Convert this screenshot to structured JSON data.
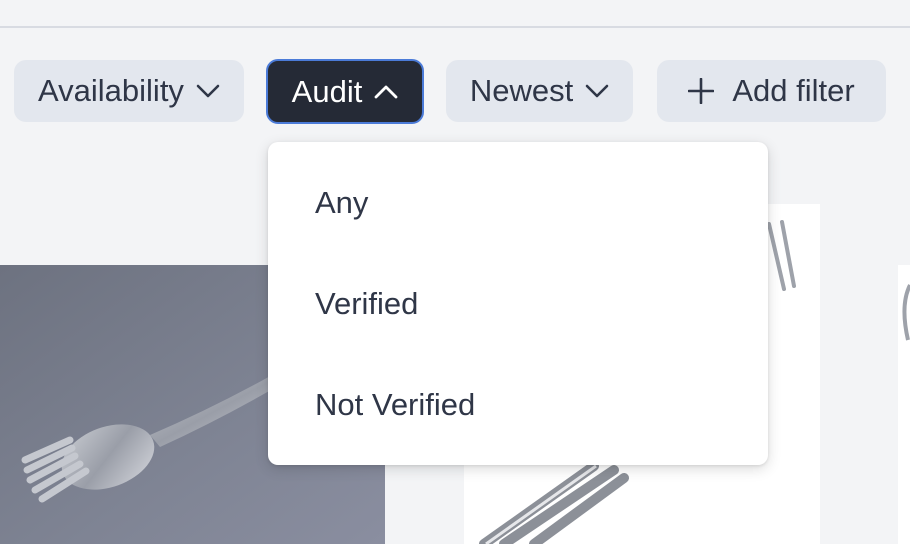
{
  "filters": {
    "availability_label": "Availability",
    "audit_label": "Audit",
    "newest_label": "Newest",
    "add_filter_label": "Add filter"
  },
  "audit_dropdown": {
    "options": [
      "Any",
      "Verified",
      "Not Verified"
    ]
  },
  "icons": {
    "chevron_down": "chevron-down-icon",
    "chevron_up": "chevron-up-icon",
    "plus": "plus-icon"
  },
  "colors": {
    "active_chip_bg": "#252a36",
    "active_chip_border": "#4b7bd8",
    "chip_bg": "#e3e7ee",
    "page_bg": "#f3f4f6"
  }
}
